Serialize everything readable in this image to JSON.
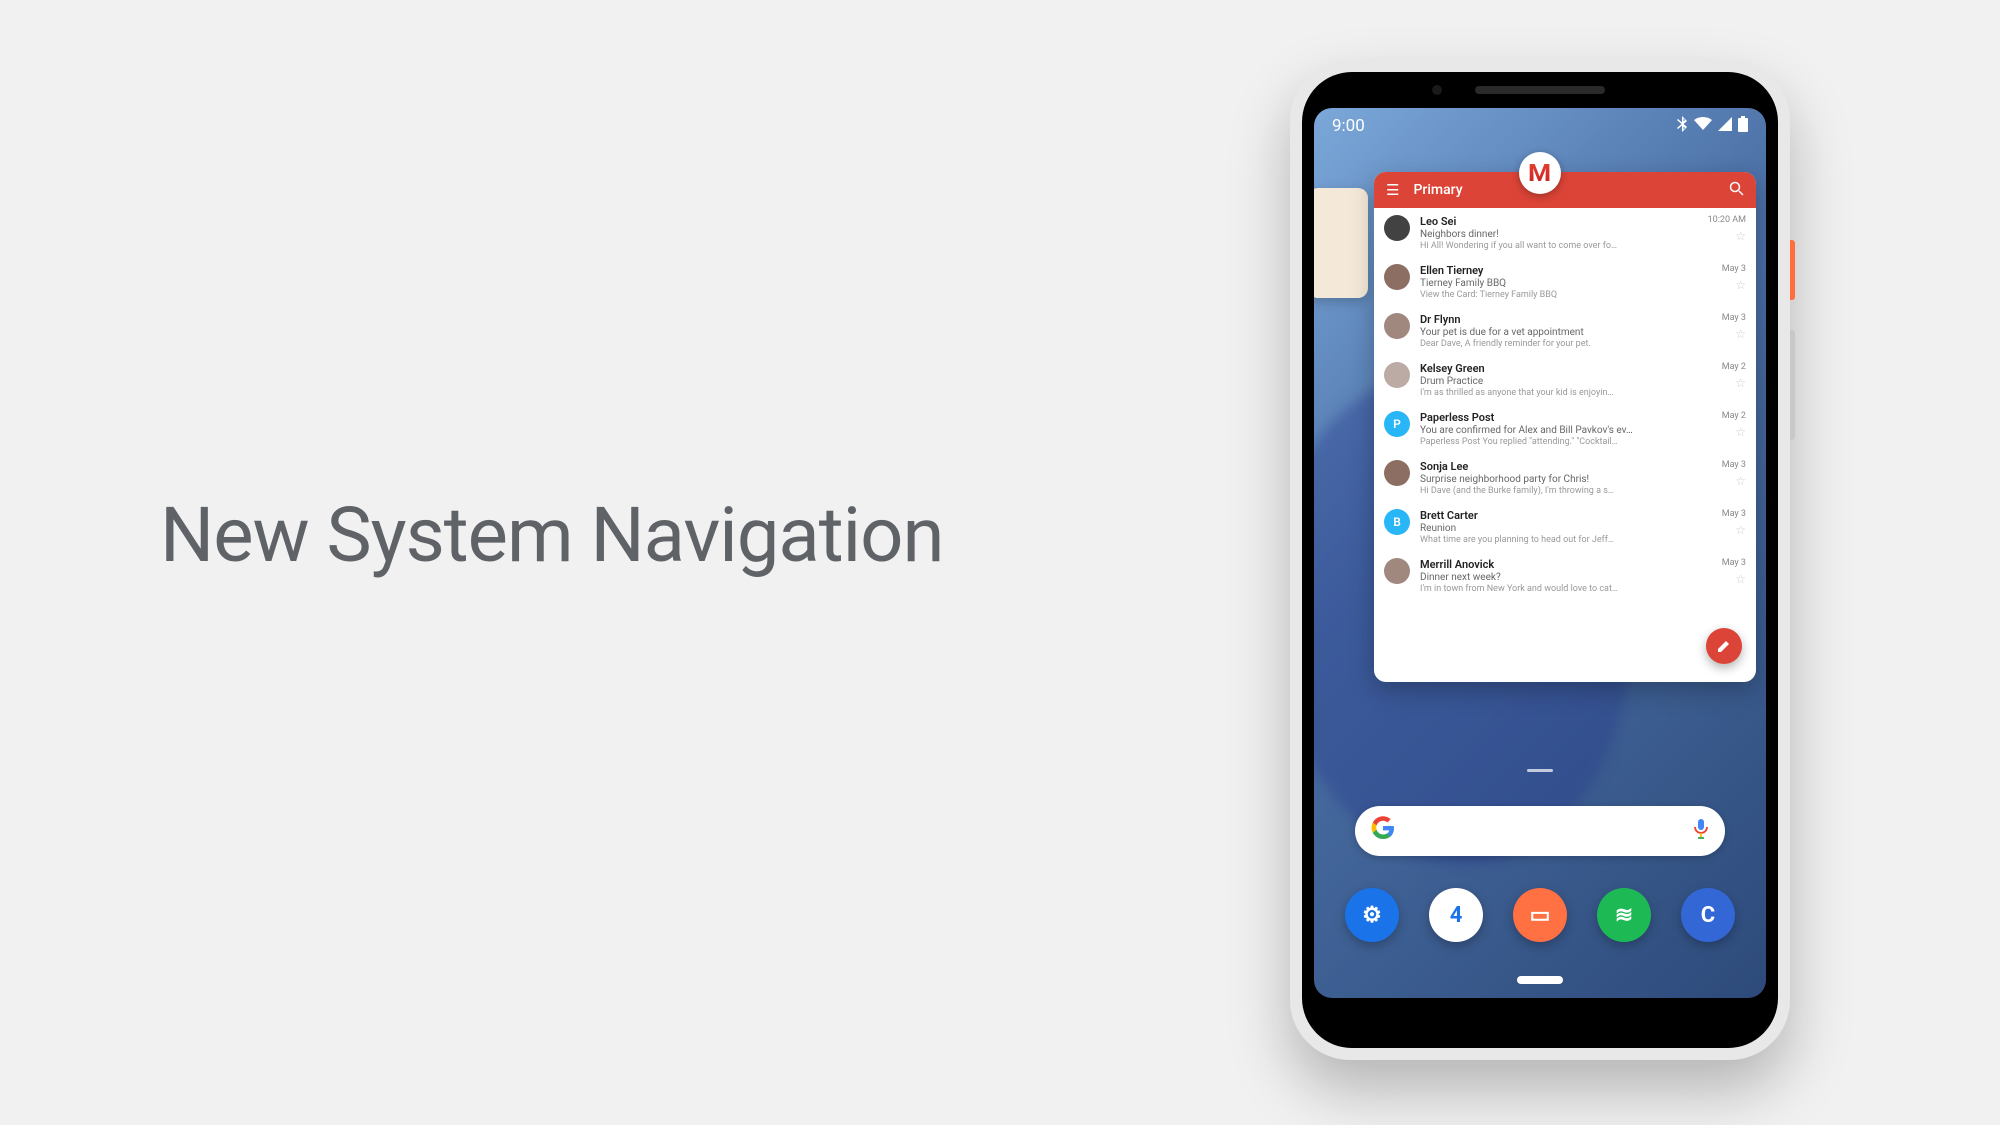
{
  "slide": {
    "title": "New System Navigation"
  },
  "status_bar": {
    "time": "9:00"
  },
  "recent_app": {
    "header_title": "Primary",
    "emails": [
      {
        "sender": "Leo Sei",
        "subject": "Neighbors dinner!",
        "snippet": "Hi All! Wondering if you all want to come over fo…",
        "time": "10:20 AM",
        "avatar_bg": "#424242"
      },
      {
        "sender": "Ellen Tierney",
        "subject": "Tierney Family BBQ",
        "snippet": "View the Card: Tierney Family BBQ",
        "time": "May 3",
        "avatar_bg": "#8d6e63"
      },
      {
        "sender": "Dr Flynn",
        "subject": "Your pet is due for a vet appointment",
        "snippet": "Dear Dave, A friendly reminder for your pet.",
        "time": "May 3",
        "avatar_bg": "#a1887f"
      },
      {
        "sender": "Kelsey Green",
        "subject": "Drum Practice",
        "snippet": "I'm as thrilled as anyone that your kid is enjoyin…",
        "time": "May 2",
        "avatar_bg": "#bcaaa4"
      },
      {
        "sender": "Paperless Post",
        "subject": "You are confirmed for Alex and Bill Pavkov's ev…",
        "snippet": "Paperless Post You replied \"attending.\" \"Cocktail…",
        "time": "May 2",
        "avatar_bg": "#29b6f6",
        "avatar_letter": "P"
      },
      {
        "sender": "Sonja Lee",
        "subject": "Surprise neighborhood party for Chris!",
        "snippet": "Hi Dave (and the Burke family), I'm throwing a s…",
        "time": "May 3",
        "avatar_bg": "#8d6e63"
      },
      {
        "sender": "Brett Carter",
        "subject": "Reunion",
        "snippet": "What time are you planning to head out for Jeff…",
        "time": "May 3",
        "avatar_bg": "#29b6f6",
        "avatar_letter": "B"
      },
      {
        "sender": "Merrill Anovick",
        "subject": "Dinner next week?",
        "snippet": "I'm in town from New York and would love to cat…",
        "time": "May 3",
        "avatar_bg": "#a1887f"
      }
    ]
  },
  "dock": {
    "apps": [
      {
        "name": "settings",
        "bg": "#1a73e8",
        "glyph": "⚙"
      },
      {
        "name": "calendar",
        "bg": "#ffffff",
        "glyph": "4",
        "fg": "#1a73e8"
      },
      {
        "name": "messages",
        "bg": "#ff7043",
        "glyph": "▭"
      },
      {
        "name": "spotify",
        "bg": "#1db954",
        "glyph": "≋"
      },
      {
        "name": "app-c",
        "bg": "#3367d6",
        "glyph": "C"
      }
    ]
  }
}
